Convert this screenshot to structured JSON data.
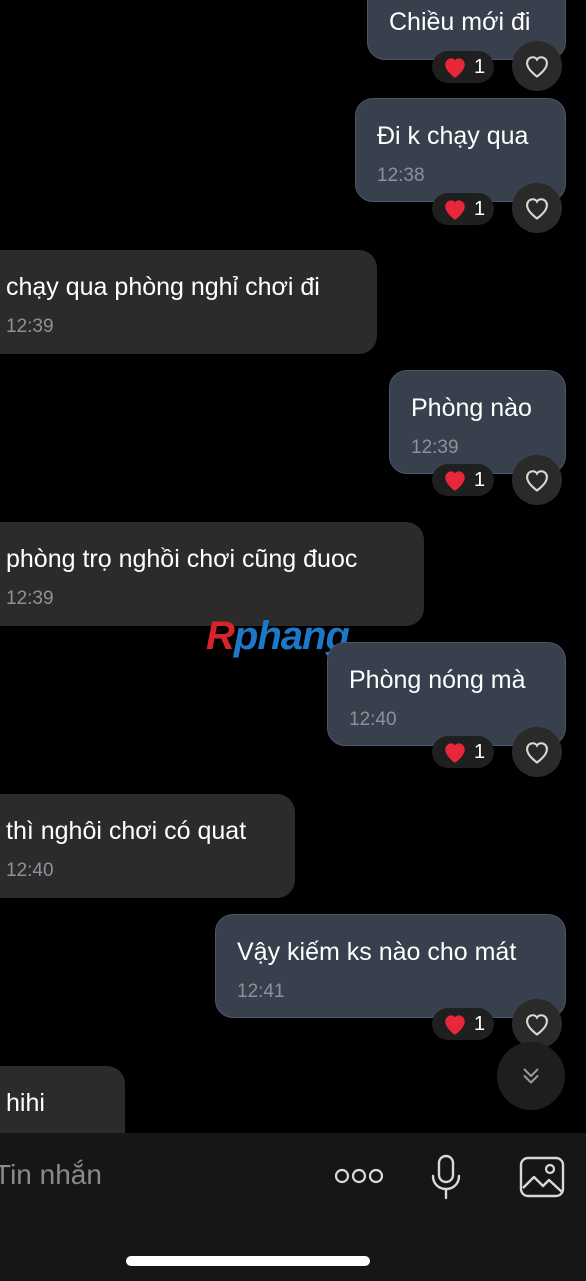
{
  "messages": [
    {
      "text": "Chiều mới đi",
      "time": "",
      "direction": "out",
      "reaction": {
        "emoji": "heart",
        "count": "1"
      }
    },
    {
      "text": "Đi k chạy qua",
      "time": "12:38",
      "direction": "out",
      "reaction": {
        "emoji": "heart",
        "count": "1"
      }
    },
    {
      "text": "chạy qua phòng nghỉ chơi đi",
      "time": "12:39",
      "direction": "in"
    },
    {
      "text": "Phòng nào",
      "time": "12:39",
      "direction": "out",
      "reaction": {
        "emoji": "heart",
        "count": "1"
      }
    },
    {
      "text": "phòng trọ nghồi chơi cũng đuoc",
      "time": "12:39",
      "direction": "in"
    },
    {
      "text": "Phòng nóng mà",
      "time": "12:40",
      "direction": "out",
      "reaction": {
        "emoji": "heart",
        "count": "1"
      }
    },
    {
      "text": "thì nghôi chơi có quat",
      "time": "12:40",
      "direction": "in"
    },
    {
      "text": "Vậy kiếm ks nào cho mát",
      "time": "12:41",
      "direction": "out",
      "reaction": {
        "emoji": "heart",
        "count": "1"
      }
    },
    {
      "text": "hihi",
      "time": "",
      "direction": "in"
    }
  ],
  "watermark": {
    "first": "R",
    "rest": "phang"
  },
  "composer": {
    "placeholder": "Tin nhắn"
  },
  "icons": {
    "reaction": "heart-icon",
    "like": "heart-outline-icon",
    "scroll": "chevrons-down-icon",
    "more": "more-dots-icon",
    "mic": "microphone-icon",
    "image": "image-icon"
  },
  "colors": {
    "background": "#000000",
    "outgoing_bubble": "#37404c",
    "incoming_bubble": "#2b2b2b",
    "heart": "#e8283a"
  }
}
